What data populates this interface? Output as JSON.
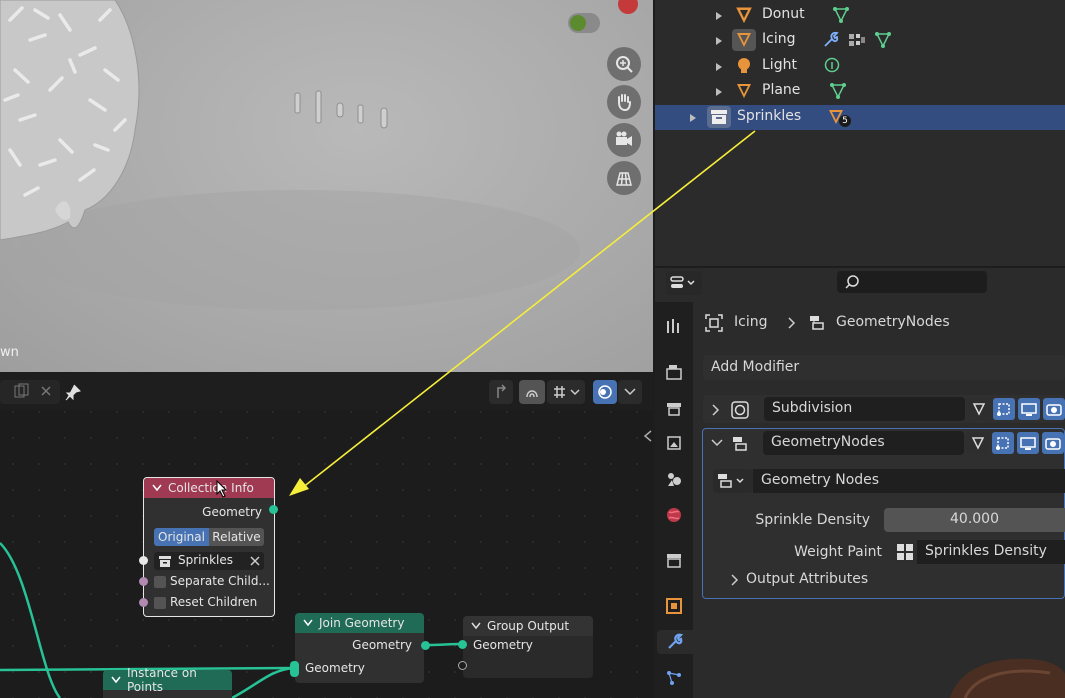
{
  "viewport": {
    "corner_label": "wn",
    "tools": [
      "zoom-icon",
      "hand-icon",
      "camera-icon",
      "grid-icon"
    ]
  },
  "outliner": {
    "items": [
      {
        "label": "Donut",
        "icons": [
          "mesh-data-icon"
        ]
      },
      {
        "label": "Icing",
        "icons": [
          "wrench-icon",
          "modifier-icon",
          "mesh-data-icon"
        ]
      },
      {
        "label": "Light",
        "icons": [
          "light-data-icon"
        ]
      },
      {
        "label": "Plane",
        "icons": [
          "mesh-data-icon"
        ]
      },
      {
        "label": "Sprinkles",
        "badge": "5",
        "selected": true
      }
    ]
  },
  "properties": {
    "breadcrumb": {
      "object": "Icing",
      "modifier": "GeometryNodes"
    },
    "add_modifier": "Add Modifier",
    "modifiers": [
      {
        "name": "Subdivision",
        "expanded": false
      },
      {
        "name": "GeometryNodes",
        "expanded": true
      }
    ],
    "node_group": "Geometry Nodes",
    "inputs": [
      {
        "label": "Sprinkle Density",
        "value": "40.000"
      },
      {
        "label": "Weight Paint",
        "value": "Sprinkles Density"
      }
    ],
    "output_attributes": "Output Attributes"
  },
  "node_editor": {
    "collection_info": {
      "title": "Collection Info",
      "output": "Geometry",
      "modes": [
        "Original",
        "Relative"
      ],
      "active_mode": "Original",
      "collection": "Sprinkles",
      "separate": "Separate Child...",
      "reset": "Reset Children"
    },
    "join_geometry": {
      "title": "Join Geometry",
      "output": "Geometry",
      "input": "Geometry"
    },
    "group_output": {
      "title": "Group Output",
      "input": "Geometry"
    },
    "instance_on_points": {
      "title": "Instance on Points"
    }
  },
  "colors": {
    "accent_blue": "#4772b3",
    "selection": "#334d80",
    "socket_geometry": "#27c295",
    "node_header_input": "#a03a52",
    "node_header_geometry": "#1f6b55",
    "annotation": "#f5ee3a"
  }
}
